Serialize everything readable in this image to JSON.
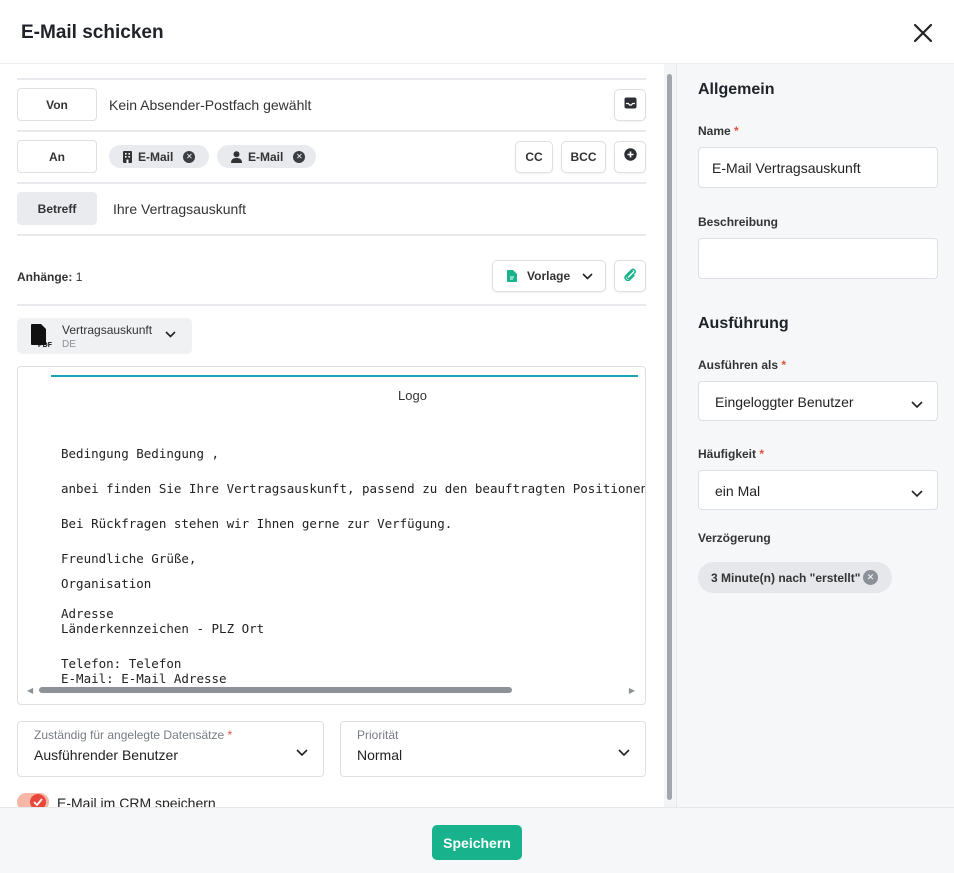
{
  "dialog": {
    "title": "E-Mail schicken"
  },
  "compose": {
    "from": {
      "label": "Von",
      "value": "Kein Absender-Postfach gewählt"
    },
    "to": {
      "label": "An",
      "recipients": [
        {
          "label": "E-Mail",
          "icon": "building-icon"
        },
        {
          "label": "E-Mail",
          "icon": "user-icon"
        }
      ],
      "cc_label": "CC",
      "bcc_label": "BCC"
    },
    "subject": {
      "label": "Betreff",
      "value": "Ihre Vertragsauskunft"
    },
    "attachments": {
      "label": "Anhänge:",
      "count": "1",
      "template_label": "Vorlage"
    },
    "attachment_file": {
      "name": "Vertragsauskunft",
      "lang": "DE",
      "type_badge": "PDF"
    }
  },
  "preview": {
    "logo": "Logo",
    "lines": [
      "Bedingung Bedingung ,",
      "anbei finden Sie Ihre Vertragsauskunft, passend zu den beauftragten Positionen.",
      "Bei Rückfragen stehen wir Ihnen gerne zur Verfügung.",
      "Freundliche Grüße,",
      "Organisation",
      "Adresse",
      "Länderkennzeichen - PLZ Ort",
      "Telefon: Telefon",
      "E-Mail: E-Mail Adresse"
    ]
  },
  "fields": {
    "responsible": {
      "label": "Zuständig für angelegte Datensätze",
      "value": "Ausführender Benutzer"
    },
    "priority": {
      "label": "Priorität",
      "value": "Normal"
    }
  },
  "save_to_crm": {
    "label": "E-Mail im CRM speichern",
    "checked": true
  },
  "sidebar": {
    "general_heading": "Allgemein",
    "name_label": "Name",
    "name_value": "E-Mail Vertragsauskunft",
    "description_label": "Beschreibung",
    "description_value": "",
    "execution_heading": "Ausführung",
    "run_as_label": "Ausführen als",
    "run_as_value": "Eingeloggter Benutzer",
    "frequency_label": "Häufigkeit",
    "frequency_value": "ein Mal",
    "delay_label": "Verzögerung",
    "delay_value": "3 Minute(n) nach \"erstellt\"",
    "required_mark": "*"
  },
  "footer": {
    "save_label": "Speichern"
  },
  "colors": {
    "primary": "#18b38c",
    "accent_line": "#1aa3b5",
    "required": "#e0503c",
    "toggle": "#e8473a"
  }
}
